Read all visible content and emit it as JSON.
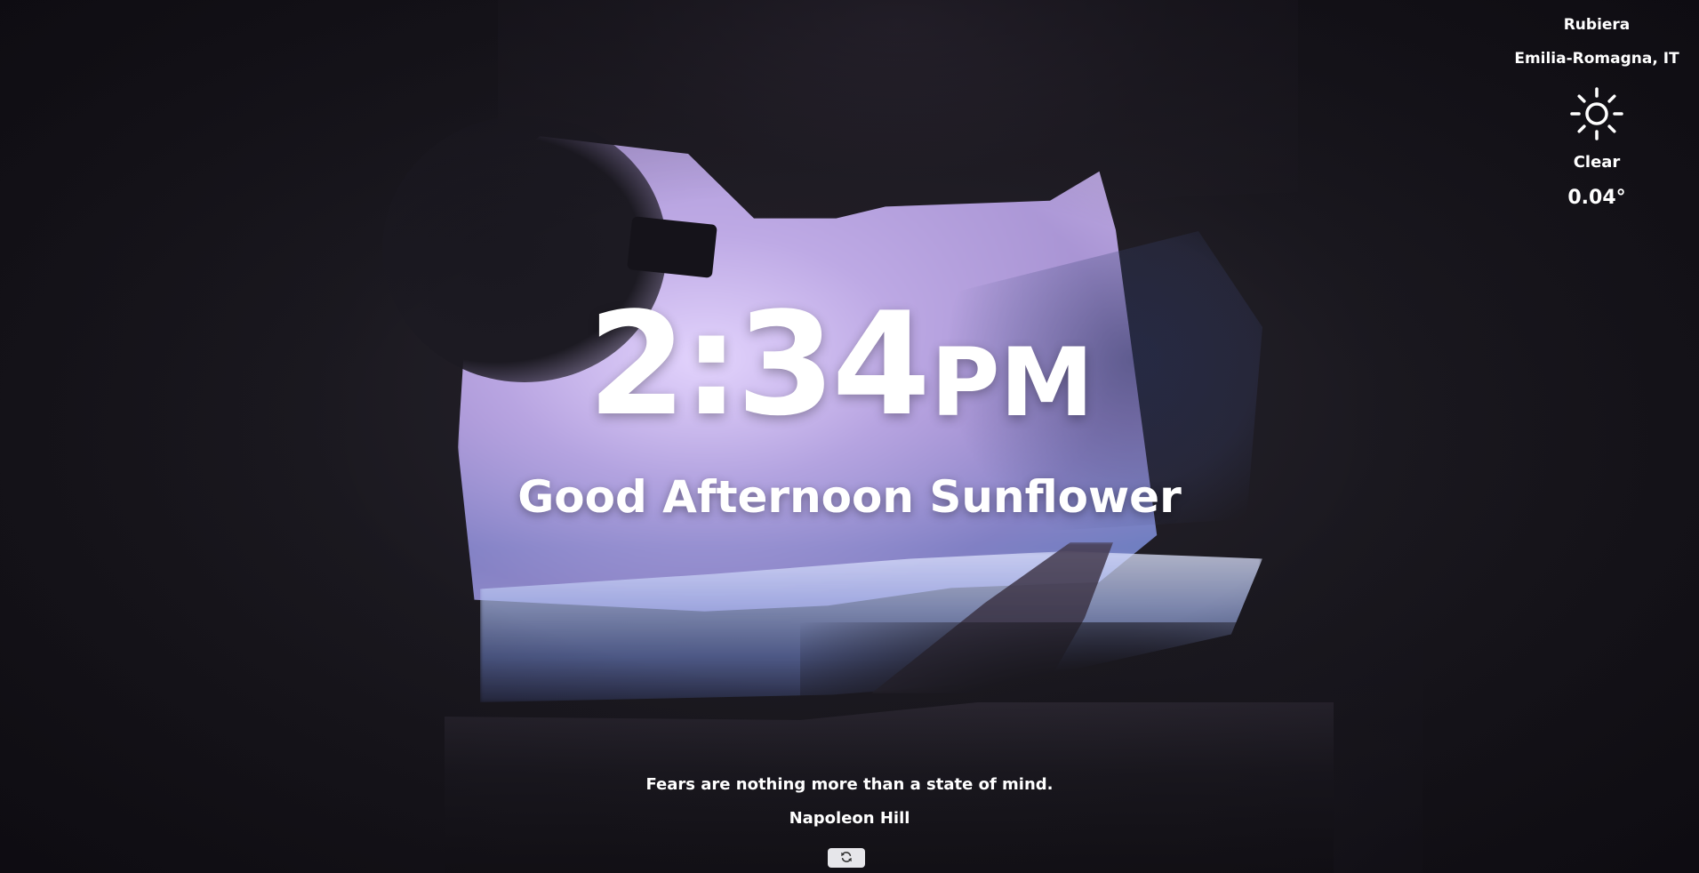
{
  "weather": {
    "city": "Rubiera",
    "region": "Emilia-Romagna, IT",
    "icon": "sun-icon",
    "condition": "Clear",
    "temperature": "0.04°"
  },
  "clock": {
    "time": "2:34",
    "period": "PM"
  },
  "greeting": "Good Afternoon Sunflower",
  "quote": {
    "text": "Fears are nothing more than a state of mind.",
    "author": "Napoleon Hill"
  },
  "refresh_button": {
    "icon": "refresh-icon"
  },
  "colors": {
    "text": "#ffffff",
    "button_bg": "#e6e6ea",
    "button_icon": "#333333"
  }
}
